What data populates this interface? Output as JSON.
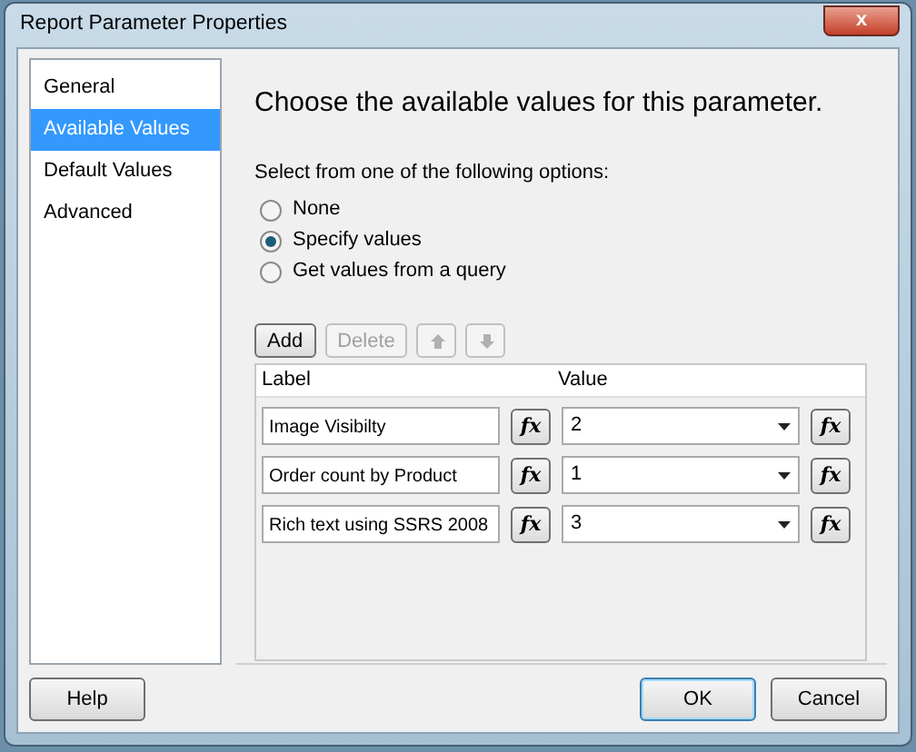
{
  "window": {
    "title": "Report Parameter Properties",
    "close_button": "x"
  },
  "sidebar": {
    "items": [
      {
        "label": "General",
        "selected": false
      },
      {
        "label": "Available Values",
        "selected": true
      },
      {
        "label": "Default Values",
        "selected": false
      },
      {
        "label": "Advanced",
        "selected": false
      }
    ]
  },
  "heading": "Choose the available values for this parameter.",
  "options_label": "Select from one of the following options:",
  "options": [
    {
      "label": "None",
      "selected": false
    },
    {
      "label": "Specify values",
      "selected": true
    },
    {
      "label": "Get values from a query",
      "selected": false
    }
  ],
  "toolbar": [
    {
      "kind": "text",
      "label": "Add",
      "disabled": false
    },
    {
      "kind": "text",
      "label": "Delete",
      "disabled": true
    },
    {
      "kind": "up",
      "disabled": true
    },
    {
      "kind": "down",
      "disabled": true
    }
  ],
  "table": {
    "columns": [
      "Label",
      "Value"
    ],
    "rows": [
      {
        "label": "Image Visibilty",
        "label_fx": "fx",
        "value": "2",
        "value_fx": "fx"
      },
      {
        "label": "Order count by Product",
        "label_fx": "fx",
        "value": "1",
        "value_fx": "fx"
      },
      {
        "label": "Rich text using SSRS 2008",
        "label_fx": "fx",
        "value": "3",
        "value_fx": "fx"
      }
    ]
  },
  "footer": {
    "help": "Help",
    "ok": "OK",
    "cancel": "Cancel"
  }
}
